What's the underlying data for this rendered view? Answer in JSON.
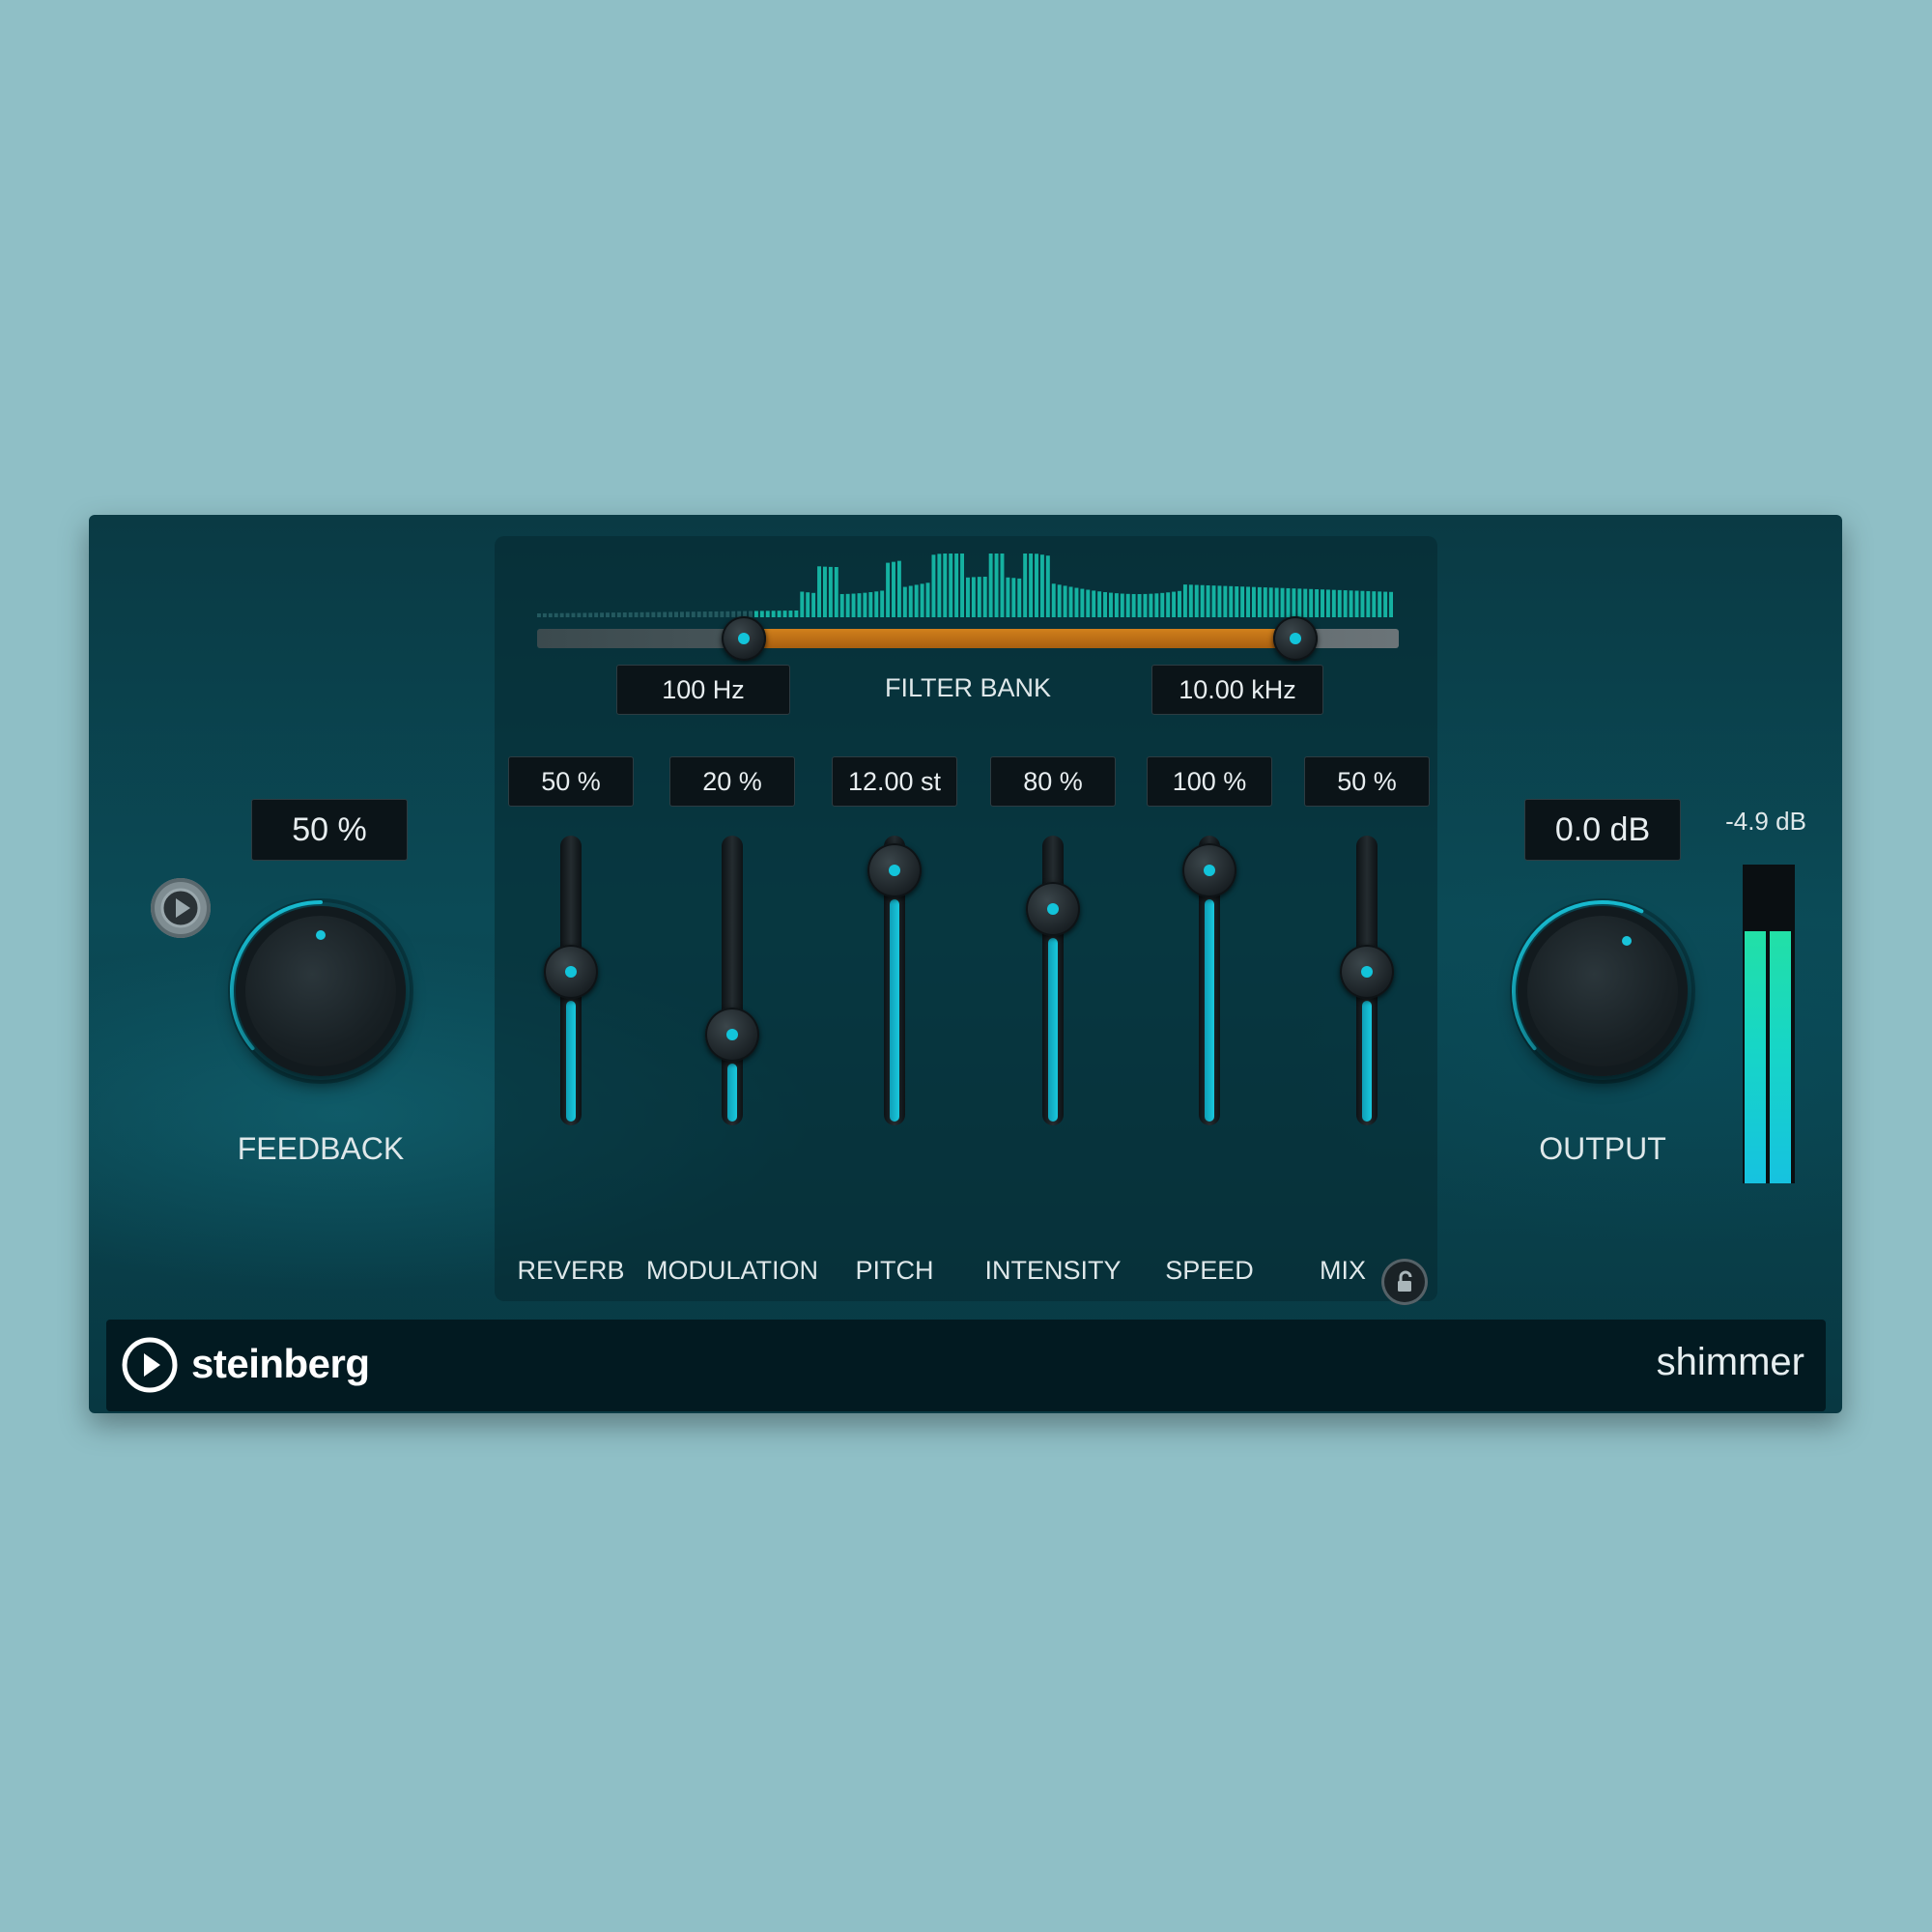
{
  "plugin": {
    "name": "shimmer",
    "brand": "steinberg"
  },
  "filter_bank": {
    "label": "FILTER BANK",
    "low_value": "100 Hz",
    "high_value": "10.00 kHz",
    "low_position": 0.24,
    "high_position": 0.88
  },
  "feedback": {
    "label": "FEEDBACK",
    "value": "50 %",
    "level": 0.5
  },
  "output": {
    "label": "OUTPUT",
    "value": "0.0 dB",
    "level": 0.6
  },
  "meter": {
    "label": "-4.9 dB",
    "level_left": 0.79,
    "level_right": 0.79
  },
  "sliders": [
    {
      "id": "reverb",
      "label": "REVERB",
      "value": "50 %",
      "level": 0.5
    },
    {
      "id": "modulation",
      "label": "MODULATION",
      "value": "20 %",
      "level": 0.24
    },
    {
      "id": "pitch",
      "label": "PITCH",
      "value": "12.00 st",
      "level": 0.92
    },
    {
      "id": "intensity",
      "label": "INTENSITY",
      "value": "80 %",
      "level": 0.76
    },
    {
      "id": "speed",
      "label": "SPEED",
      "value": "100 %",
      "level": 0.92
    },
    {
      "id": "mix",
      "label": "MIX",
      "value": "50 %",
      "level": 0.5
    }
  ],
  "icons": {
    "play": "play-circle-icon",
    "lock": "unlock-icon",
    "logo": "steinberg-logo-icon"
  },
  "colors": {
    "accent": "#19c4da",
    "range": "#c8781a",
    "background": "#0b4a56"
  }
}
